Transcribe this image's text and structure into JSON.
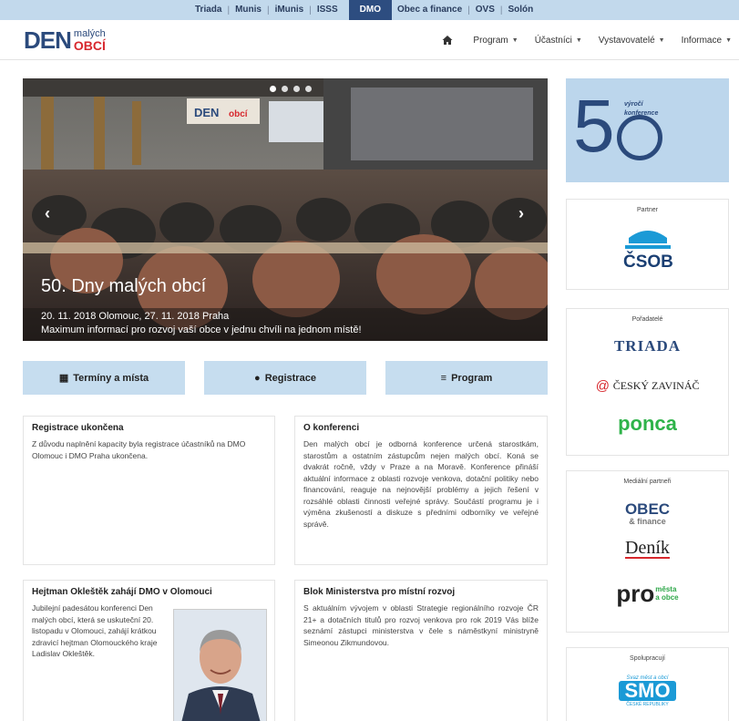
{
  "topbar": {
    "items": [
      "Triada",
      "Munis",
      "iMunis",
      "ISSS",
      "DMO",
      "Obec a finance",
      "OVS",
      "Solón"
    ],
    "active": "DMO"
  },
  "logo": {
    "den": "DEN",
    "line1": "malých",
    "line2": "OBCÍ"
  },
  "nav": {
    "items": [
      {
        "label": "Program"
      },
      {
        "label": "Účastníci"
      },
      {
        "label": "Vystavovatelé"
      },
      {
        "label": "Informace"
      }
    ]
  },
  "slider": {
    "title": "50. Dny malých obcí",
    "line1": "20. 11. 2018 Olomouc, 27. 11. 2018 Praha",
    "line2": "Maximum informací pro rozvoj vaší obce v jednu chvíli na jednom místě!",
    "banner": "DEN malých obcí"
  },
  "buttons": {
    "terms": "Termíny a místa",
    "registration": "Registrace",
    "program": "Program"
  },
  "boxes": {
    "reg": {
      "title": "Registrace ukončena",
      "text": "Z důvodu naplnění kapacity byla registrace účastníků na DMO Olomouc i DMO Praha ukončena."
    },
    "about": {
      "title": "O konferenci",
      "text": "Den malých obcí je odborná konference určená starostkám, starostům a ostatním zástupcům nejen malých obcí. Koná se dvakrát ročně, vždy v Praze a na Moravě. Konference přináší aktuální informace z oblasti rozvoje venkova, dotační politiky nebo financování, reaguje na nejnovější problémy a jejich řešení v rozsáhlé oblasti činnosti veřejné správy. Součástí programu je i výměna zkušeností a diskuze s předními odborníky ve veřejné správě."
    },
    "hejtman": {
      "title": "Hejtman Okleštěk zahájí DMO v Olomouci",
      "text": "Jubilejní padesátou konferenci Den malých obcí, která se uskuteční 20. listopadu v Olomouci, zahájí krátkou zdravicí hejtman Olomouckého kraje Ladislav Okleštěk."
    },
    "mmr": {
      "title": "Blok Ministerstva pro místní rozvoj",
      "text": "S aktuálním vývojem v oblasti Strategie regionálního rozvoje ČR 21+ a dotačních titulů pro rozvoj venkova pro rok 2019 Vás blíže seznámí zástupci ministerstva v čele s náměstkyní ministryně Simeonou Zikmundovou."
    }
  },
  "sidebar": {
    "anniversary": {
      "number": "5",
      "line1": "výročí",
      "line2": "konference"
    },
    "partner": {
      "label": "Partner",
      "logo": "ČSOB"
    },
    "organizer": {
      "label": "Pořadatelé",
      "logos": [
        "TRIADA",
        "ČESKÝ ZAVINÁČ",
        "ponca"
      ]
    },
    "media": {
      "label": "Mediální partneři",
      "logos": [
        "OBEC",
        "& finance",
        "Deník",
        "pro",
        "města",
        "a obce"
      ]
    },
    "coop": {
      "label": "Spolupracují",
      "logo": "SMO",
      "sub": "ČESKÉ REPUBLIKY",
      "arc": "Svaz měst a obcí"
    }
  },
  "colors": {
    "accent": "#2b4a7c",
    "lightblue": "#c6ddef",
    "red": "#d7272d"
  }
}
